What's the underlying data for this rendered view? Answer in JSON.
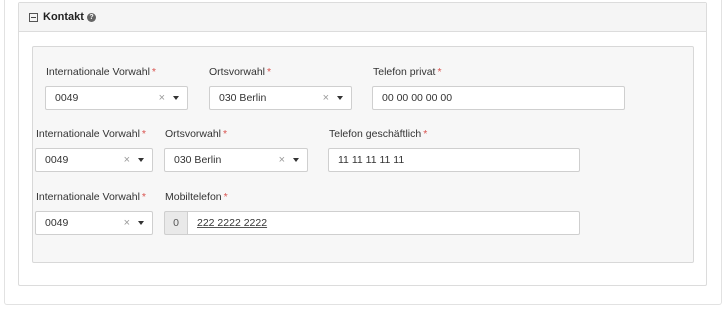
{
  "panel": {
    "title": "Kontakt",
    "help_icon": "question-circle-icon",
    "toggle_icon": "minus-square-icon"
  },
  "required_marker": "*",
  "rows": [
    {
      "country_code": {
        "label": "Internationale Vorwahl",
        "value": "0049"
      },
      "area_code": {
        "label": "Ortsvorwahl",
        "value": "030 Berlin"
      },
      "phone": {
        "label": "Telefon privat",
        "value": "00 00 00 00 00"
      }
    },
    {
      "country_code": {
        "label": "Internationale Vorwahl",
        "value": "0049"
      },
      "area_code": {
        "label": "Ortsvorwahl",
        "value": "030 Berlin"
      },
      "phone": {
        "label": "Telefon geschäftlich",
        "value": "11 11 11 11 11"
      }
    },
    {
      "country_code": {
        "label": "Internationale Vorwahl",
        "value": "0049"
      },
      "mobile": {
        "label": "Mobiltelefon",
        "prefix": "0",
        "value": "222 2222 2222"
      }
    }
  ],
  "clear_glyph": "×"
}
